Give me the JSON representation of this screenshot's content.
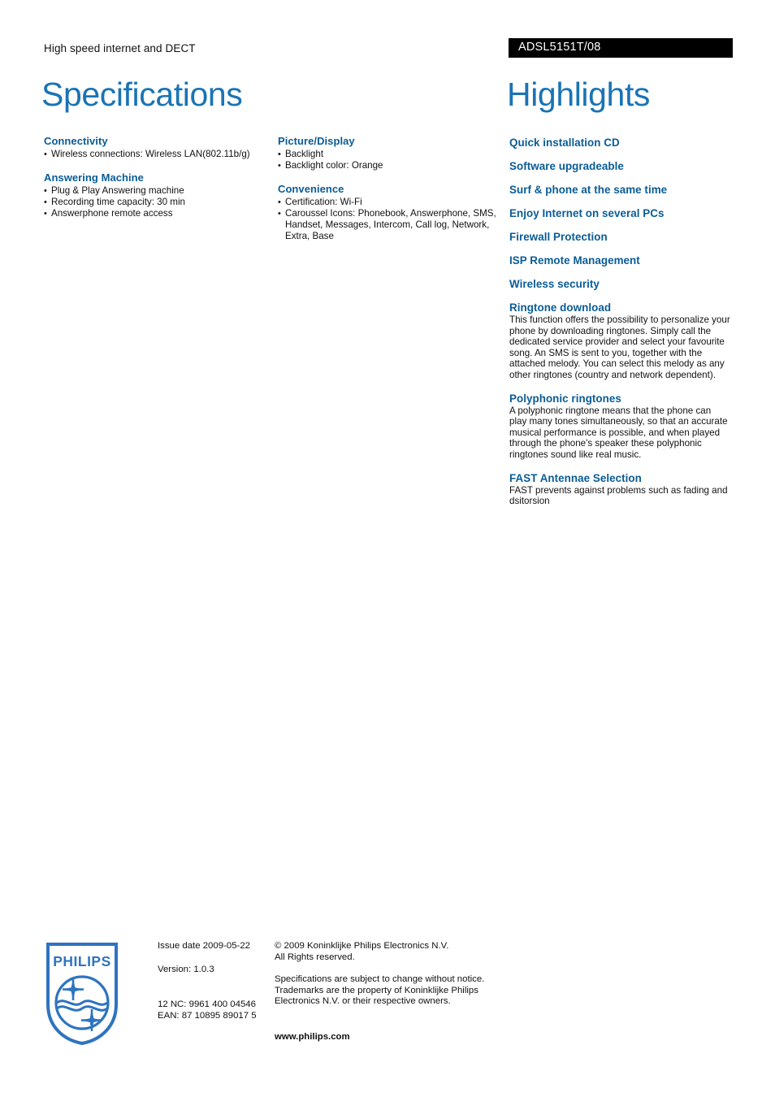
{
  "header": {
    "kicker": "High speed internet and DECT",
    "product_code": "ADSL5151T/08",
    "title_left": "Specifications",
    "title_right": "Highlights",
    "banner_bg": "#000000",
    "banner_text_color": "#ffffff",
    "title_color": "#1a74b4",
    "heading_color": "#0a5c97"
  },
  "specifications": {
    "column1": [
      {
        "heading": "Connectivity",
        "items": [
          "Wireless connections: Wireless LAN(802.11b/g)"
        ]
      },
      {
        "heading": "Answering Machine",
        "items": [
          "Plug & Play Answering machine",
          "Recording time capacity: 30 min",
          "Answerphone remote access"
        ]
      }
    ],
    "column2": [
      {
        "heading": "Picture/Display",
        "items": [
          "Backlight",
          "Backlight color: Orange"
        ]
      },
      {
        "heading": "Convenience",
        "items": [
          "Certification: Wi-Fi",
          "Caroussel Icons: Phonebook, Answerphone, SMS, Handset, Messages, Intercom, Call log, Network, Extra, Base"
        ]
      }
    ]
  },
  "highlights": [
    {
      "heading": "Quick installation CD",
      "body": ""
    },
    {
      "heading": "Software upgradeable",
      "body": ""
    },
    {
      "heading": "Surf & phone at the same time",
      "body": ""
    },
    {
      "heading": "Enjoy Internet on several PCs",
      "body": ""
    },
    {
      "heading": "Firewall Protection",
      "body": ""
    },
    {
      "heading": "ISP Remote Management",
      "body": ""
    },
    {
      "heading": "Wireless security",
      "body": ""
    },
    {
      "heading": "Ringtone download",
      "body": "This function offers the possibility to personalize your phone by downloading ringtones. Simply call the dedicated service provider and select your favourite song. An SMS is sent to you, together with the attached melody. You can select this melody as any other ringtones (country and network dependent)."
    },
    {
      "heading": "Polyphonic ringtones",
      "body": "A polyphonic ringtone means that the phone can play many tones simultaneously, so that an accurate musical performance is possible, and when played through the phone's speaker these polyphonic ringtones sound like real music."
    },
    {
      "heading": "FAST Antennae Selection",
      "body": "FAST prevents against problems such as fading and dsitorsion"
    }
  ],
  "footer": {
    "logo_text": "PHILIPS",
    "logo_color": "#2e74c0",
    "issue_date": "Issue date 2009-05-22",
    "version": "Version: 1.0.3",
    "nc_code": "12 NC: 9961 400 04546",
    "ean_code": "EAN: 87 10895 89017 5",
    "copyright": "© 2009 Koninklijke Philips Electronics N.V.\nAll Rights reserved.",
    "disclaimer": "Specifications are subject to change without notice.\nTrademarks are the property of Koninklijke Philips\nElectronics N.V. or their respective owners.",
    "website": "www.philips.com"
  }
}
